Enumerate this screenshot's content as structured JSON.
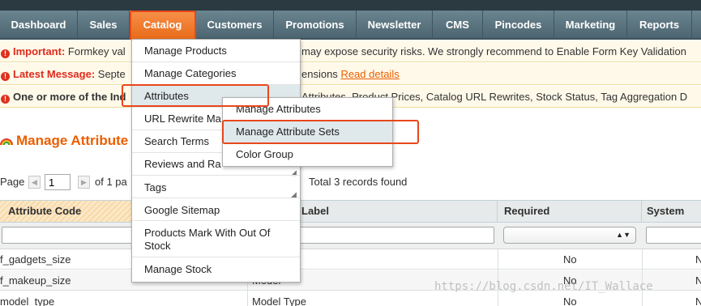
{
  "nav": {
    "items": [
      {
        "label": "Dashboard"
      },
      {
        "label": "Sales"
      },
      {
        "label": "Catalog"
      },
      {
        "label": "Customers"
      },
      {
        "label": "Promotions"
      },
      {
        "label": "Newsletter"
      },
      {
        "label": "CMS"
      },
      {
        "label": "Pincodes"
      },
      {
        "label": "Marketing"
      },
      {
        "label": "Reports"
      }
    ],
    "active_color": "#e76a18"
  },
  "messages": {
    "important_title": "Important:",
    "important_text_a": "Formkey val",
    "important_text_b": "may expose security risks. We strongly recommend to Enable Form Key Validation",
    "latest_title": "Latest Message:",
    "latest_text_a": "Septe",
    "latest_text_b": "ensions",
    "latest_link": "Read details",
    "index_title": "One or more of the Ind",
    "index_text_b": "Attributes, Product Prices, Catalog URL Rewrites, Stock Status, Tag Aggregation D"
  },
  "page": {
    "heading": "Manage Attribute",
    "pager_prefix": "Page",
    "pager_value": "1",
    "pager_of": "of 1 pa",
    "total": "Total 3 records found"
  },
  "grid": {
    "headers": {
      "code": "Attribute Code",
      "label": "Label",
      "required": "Required",
      "system": "System"
    },
    "rows": [
      {
        "code": "f_gadgets_size",
        "label": "",
        "required": "No",
        "system": "N"
      },
      {
        "code": "f_makeup_size",
        "label": "Model",
        "required": "No",
        "system": "N"
      },
      {
        "code": "model_type",
        "label": "Model Type",
        "required": "No",
        "system": "N"
      }
    ]
  },
  "catalog_menu": {
    "items": [
      {
        "label": "Manage Products"
      },
      {
        "label": "Manage Categories"
      },
      {
        "label": "Attributes"
      },
      {
        "label": "URL Rewrite Ma"
      },
      {
        "label": "Search Terms"
      },
      {
        "label": "Reviews and Ra"
      },
      {
        "label": "Tags"
      },
      {
        "label": "Google Sitemap"
      },
      {
        "label": "Products Mark With Out Of Stock"
      },
      {
        "label": "Manage Stock"
      }
    ]
  },
  "attributes_submenu": {
    "items": [
      {
        "label": "Manage Attributes"
      },
      {
        "label": "Manage Attribute Sets"
      },
      {
        "label": "Color Group"
      }
    ]
  },
  "watermark": "https://blog.csdn.net/IT_Wallace",
  "colors": {
    "highlight_frame": "#e8481c",
    "heading": "#eb5e00",
    "menu_hover": "#dfe8eb"
  }
}
